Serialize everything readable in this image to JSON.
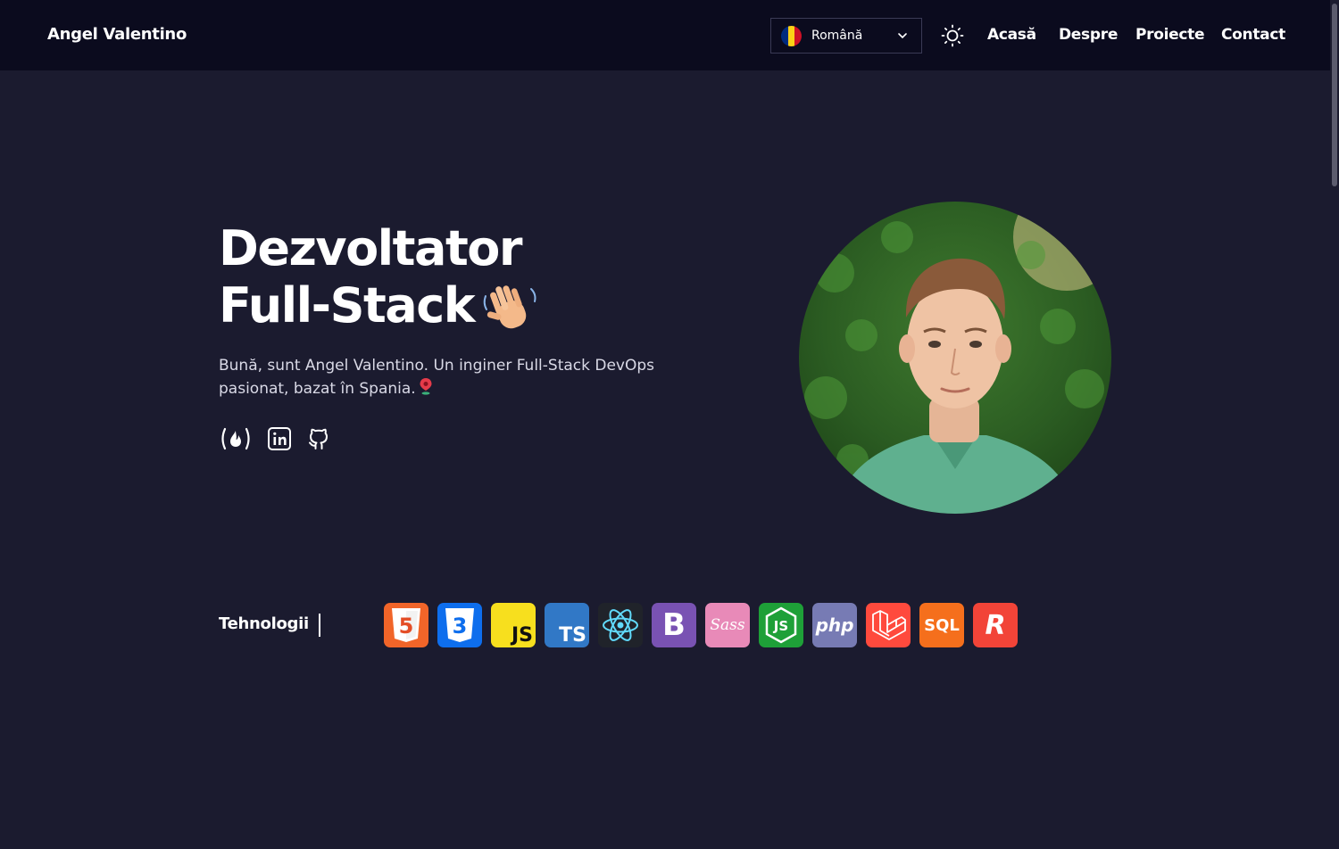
{
  "header": {
    "brand": "Angel Valentino",
    "language": {
      "selected": "Română",
      "flag_colors": [
        "#002b7f",
        "#fcd116",
        "#ce1126"
      ]
    },
    "theme_toggle_icon": "sun-icon",
    "nav": [
      "Acasă",
      "Despre",
      "Proiecte",
      "Contact"
    ]
  },
  "hero": {
    "title_line1": "Dezvoltator",
    "title_line2": "Full-Stack",
    "title_emoji": "waving-hand-icon",
    "description": "Bună, sunt Angel Valentino. Un inginer Full-Stack DevOps pasionat, bazat în Spania.",
    "description_icon": "location-pin-icon",
    "socials": [
      "freecodecamp-icon",
      "linkedin-icon",
      "github-icon"
    ],
    "portrait": "profile-photo"
  },
  "tech": {
    "label": "Tehnologii",
    "items": [
      {
        "name": "html5-icon",
        "glyph": "5",
        "color": "#e44d26"
      },
      {
        "name": "css3-icon",
        "glyph": "3",
        "color": "#1572b6"
      },
      {
        "name": "javascript-icon",
        "glyph": "JS",
        "color": "#f7df1e"
      },
      {
        "name": "typescript-icon",
        "glyph": "TS",
        "color": "#3178c6"
      },
      {
        "name": "react-icon",
        "glyph": "",
        "color": "#20232a"
      },
      {
        "name": "bootstrap-icon",
        "glyph": "B",
        "color": "#7952b3"
      },
      {
        "name": "sass-icon",
        "glyph": "Sass",
        "color": "#cc6699"
      },
      {
        "name": "nodejs-icon",
        "glyph": "JS",
        "color": "#339933"
      },
      {
        "name": "php-icon",
        "glyph": "php",
        "color": "#777bb4"
      },
      {
        "name": "laravel-icon",
        "glyph": "",
        "color": "#ff2d20"
      },
      {
        "name": "sql-icon",
        "glyph": "SQL",
        "color": "#f29111"
      },
      {
        "name": "redux-saga-icon",
        "glyph": "R",
        "color": "#f04438"
      }
    ]
  }
}
